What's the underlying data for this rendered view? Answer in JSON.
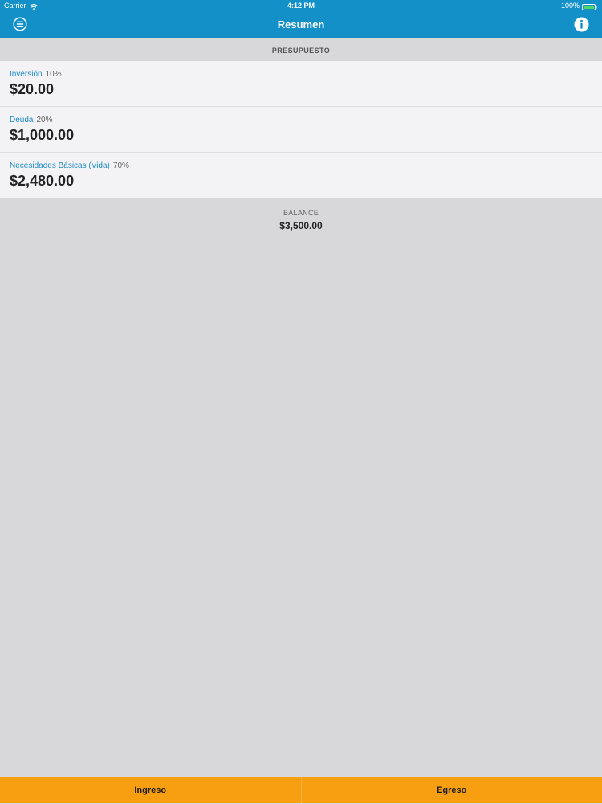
{
  "status_bar": {
    "carrier": "Carrier",
    "time": "4:12 PM",
    "battery": "100%",
    "battery_color": "#4cd964"
  },
  "nav": {
    "title": "Resumen",
    "left_icon": "menu-icon",
    "right_icon": "info-icon",
    "bar_color": "#1390c8"
  },
  "budget": {
    "header": "PRESUPUESTO",
    "items": [
      {
        "name": "Inversión",
        "percent": "10%",
        "amount": "$20.00"
      },
      {
        "name": "Deuda",
        "percent": "20%",
        "amount": "$1,000.00"
      },
      {
        "name": "Necesidades Básicas (Vida)",
        "percent": "70%",
        "amount": "$2,480.00"
      }
    ]
  },
  "balance": {
    "label": "BALANCE",
    "value": "$3,500.00"
  },
  "bottom_bar": {
    "income_label": "Ingreso",
    "expense_label": "Egreso",
    "bar_color": "#f79f10"
  }
}
